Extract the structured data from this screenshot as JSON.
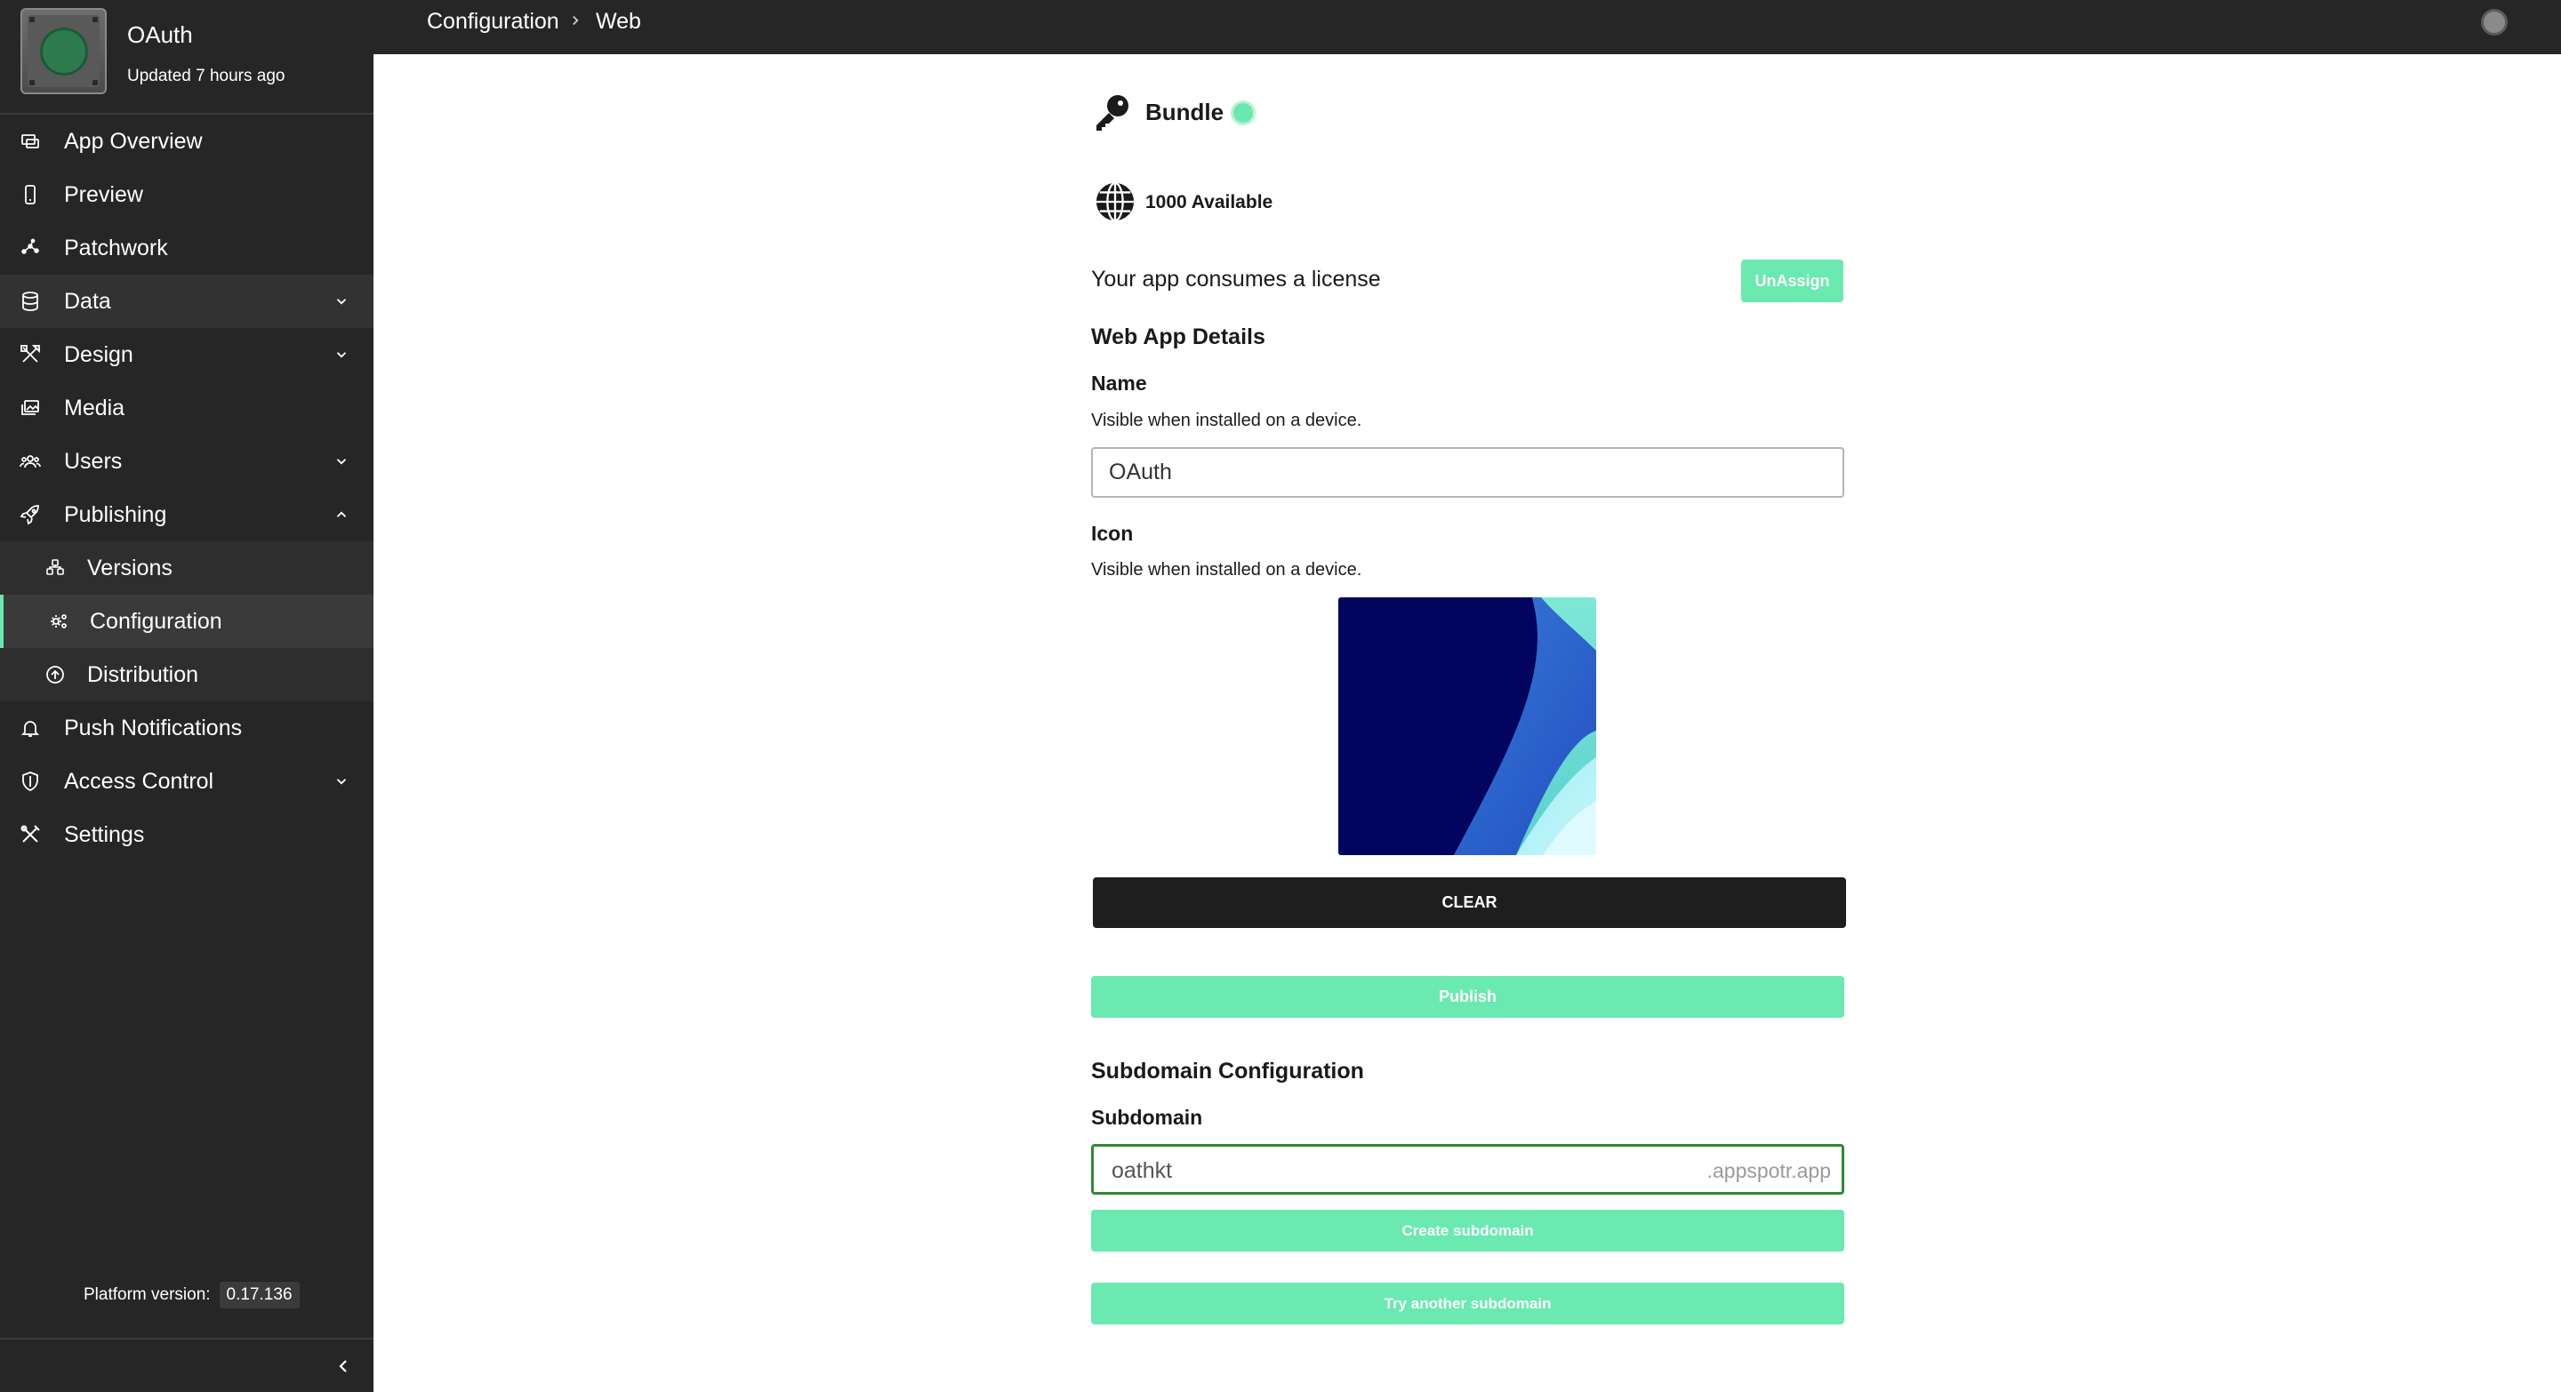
{
  "app": {
    "name": "OAuth",
    "updated": "Updated 7 hours ago"
  },
  "sidebar": {
    "items": [
      {
        "label": "App Overview",
        "icon": "overview-icon"
      },
      {
        "label": "Preview",
        "icon": "phone-icon"
      },
      {
        "label": "Patchwork",
        "icon": "nodes-icon"
      },
      {
        "label": "Data",
        "icon": "database-icon",
        "expand": "chevron-down"
      },
      {
        "label": "Design",
        "icon": "design-tools-icon",
        "expand": "chevron-down"
      },
      {
        "label": "Media",
        "icon": "media-icon"
      },
      {
        "label": "Users",
        "icon": "users-icon",
        "expand": "chevron-down"
      },
      {
        "label": "Publishing",
        "icon": "rocket-icon",
        "expand": "chevron-up"
      },
      {
        "label": "Versions",
        "icon": "versions-icon"
      },
      {
        "label": "Configuration",
        "icon": "gear-icon",
        "active": true
      },
      {
        "label": "Distribution",
        "icon": "upload-icon"
      },
      {
        "label": "Push Notifications",
        "icon": "bell-icon"
      },
      {
        "label": "Access Control",
        "icon": "shield-icon",
        "expand": "chevron-down"
      },
      {
        "label": "Settings",
        "icon": "tools-icon"
      }
    ],
    "platform_label": "Platform version:",
    "platform_version": "0.17.136"
  },
  "breadcrumb": {
    "first": "Configuration",
    "second": "Web"
  },
  "bundle": {
    "title": "Bundle",
    "status_color": "#6be8b0"
  },
  "license": {
    "available": "1000 Available",
    "message": "Your app consumes a license",
    "unassign_label": "UnAssign"
  },
  "web_app": {
    "heading": "Web App Details",
    "name_label": "Name",
    "name_help": "Visible when installed on a device.",
    "name_value": "OAuth",
    "icon_label": "Icon",
    "icon_help": "Visible when installed on a device.",
    "clear_label": "CLEAR",
    "publish_label": "Publish"
  },
  "subdomain": {
    "heading": "Subdomain Configuration",
    "label": "Subdomain",
    "value": "oathkt",
    "suffix": ".appspotr.app",
    "create_label": "Create subdomain",
    "try_label": "Try another subdomain"
  },
  "colors": {
    "accent": "#6ae9b1",
    "sidebar_bg": "#262626",
    "input_focus": "#2d8a35"
  }
}
